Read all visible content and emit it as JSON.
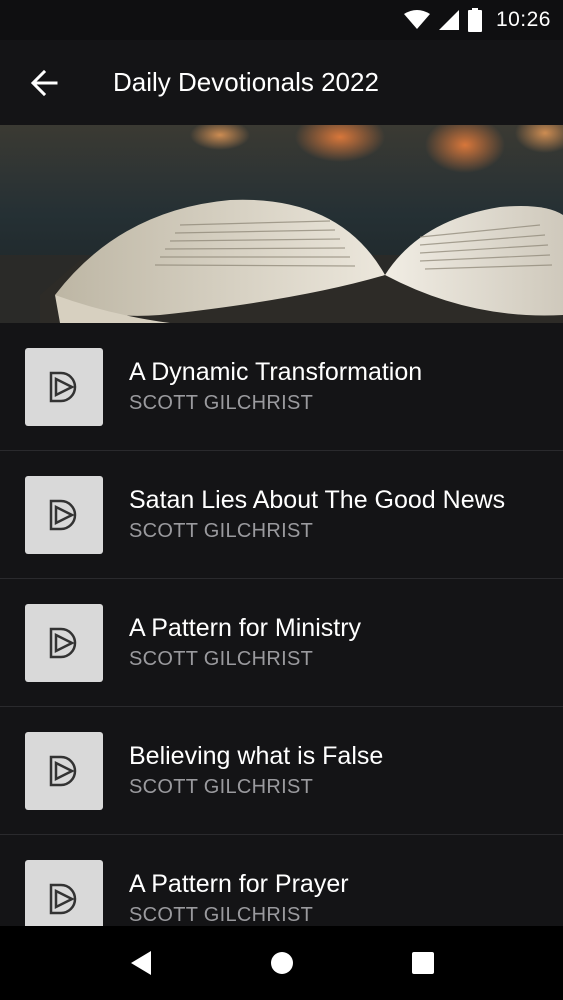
{
  "status": {
    "time": "10:26",
    "icons": [
      "wifi-icon",
      "signal-icon",
      "battery-icon"
    ]
  },
  "header": {
    "title": "Daily Devotionals 2022",
    "back_icon": "arrow-left-icon"
  },
  "hero": {
    "image": "open-bible-photo"
  },
  "devotionals": [
    {
      "title": "A Dynamic Transformation",
      "author": "SCOTT GILCHRIST"
    },
    {
      "title": "Satan Lies About The Good News",
      "author": "SCOTT GILCHRIST"
    },
    {
      "title": "A Pattern for Ministry",
      "author": "SCOTT GILCHRIST"
    },
    {
      "title": "Believing what is False",
      "author": "SCOTT GILCHRIST"
    },
    {
      "title": "A Pattern for Prayer",
      "author": "SCOTT GILCHRIST"
    }
  ],
  "navigation": {
    "buttons": [
      "back-triangle-icon",
      "home-circle-icon",
      "recents-square-icon"
    ]
  },
  "colors": {
    "background": "#141416",
    "thumb": "#d9d9d9",
    "author_text": "#9a9a9e"
  }
}
